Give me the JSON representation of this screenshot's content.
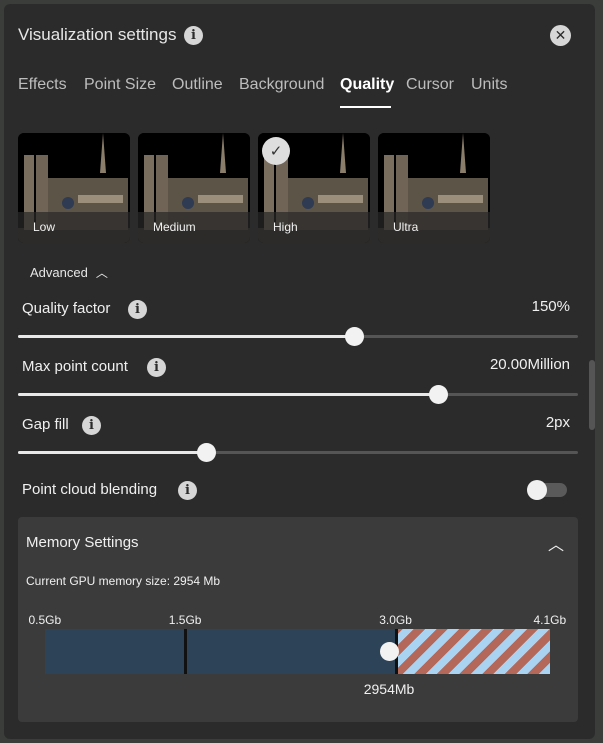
{
  "header": {
    "title": "Visualization settings"
  },
  "tabs": [
    {
      "label": "Effects"
    },
    {
      "label": "Point Size"
    },
    {
      "label": "Outline"
    },
    {
      "label": "Background"
    },
    {
      "label": "Quality"
    },
    {
      "label": "Cursor"
    },
    {
      "label": "Units"
    }
  ],
  "active_tab": "Quality",
  "presets": [
    {
      "label": "Low"
    },
    {
      "label": "Medium"
    },
    {
      "label": "High",
      "selected": true
    },
    {
      "label": "Ultra"
    }
  ],
  "advanced": {
    "label": "Advanced",
    "expanded": true
  },
  "settings": {
    "quality_factor": {
      "label": "Quality factor",
      "value": "150%",
      "fraction": 0.6
    },
    "max_point_count": {
      "label": "Max point count",
      "value": "20.00Million",
      "fraction": 0.75
    },
    "gap_fill": {
      "label": "Gap fill",
      "value": "2px",
      "fraction": 0.335
    },
    "point_cloud_blending": {
      "label": "Point cloud blending",
      "enabled": false
    }
  },
  "memory": {
    "title": "Memory Settings",
    "current_label": "Current GPU memory size: 2954 Mb",
    "ticks": [
      {
        "label": "0.5Gb",
        "gb": 0.5
      },
      {
        "label": "1.5Gb",
        "gb": 1.5
      },
      {
        "label": "3.0Gb",
        "gb": 3.0
      },
      {
        "label": "4.1Gb",
        "gb": 4.1
      }
    ],
    "value_label": "2954Mb",
    "value_mb": 2954
  },
  "icons": {
    "info": "info-icon",
    "close": "close-icon",
    "check": "check-icon",
    "chevron_up": "chevron-up-icon"
  },
  "colors": {
    "panel": "#2b2b2b",
    "memory_used": "#2d4357",
    "stripe_blue": "#a9d3f0",
    "stripe_red": "#b4685a"
  }
}
